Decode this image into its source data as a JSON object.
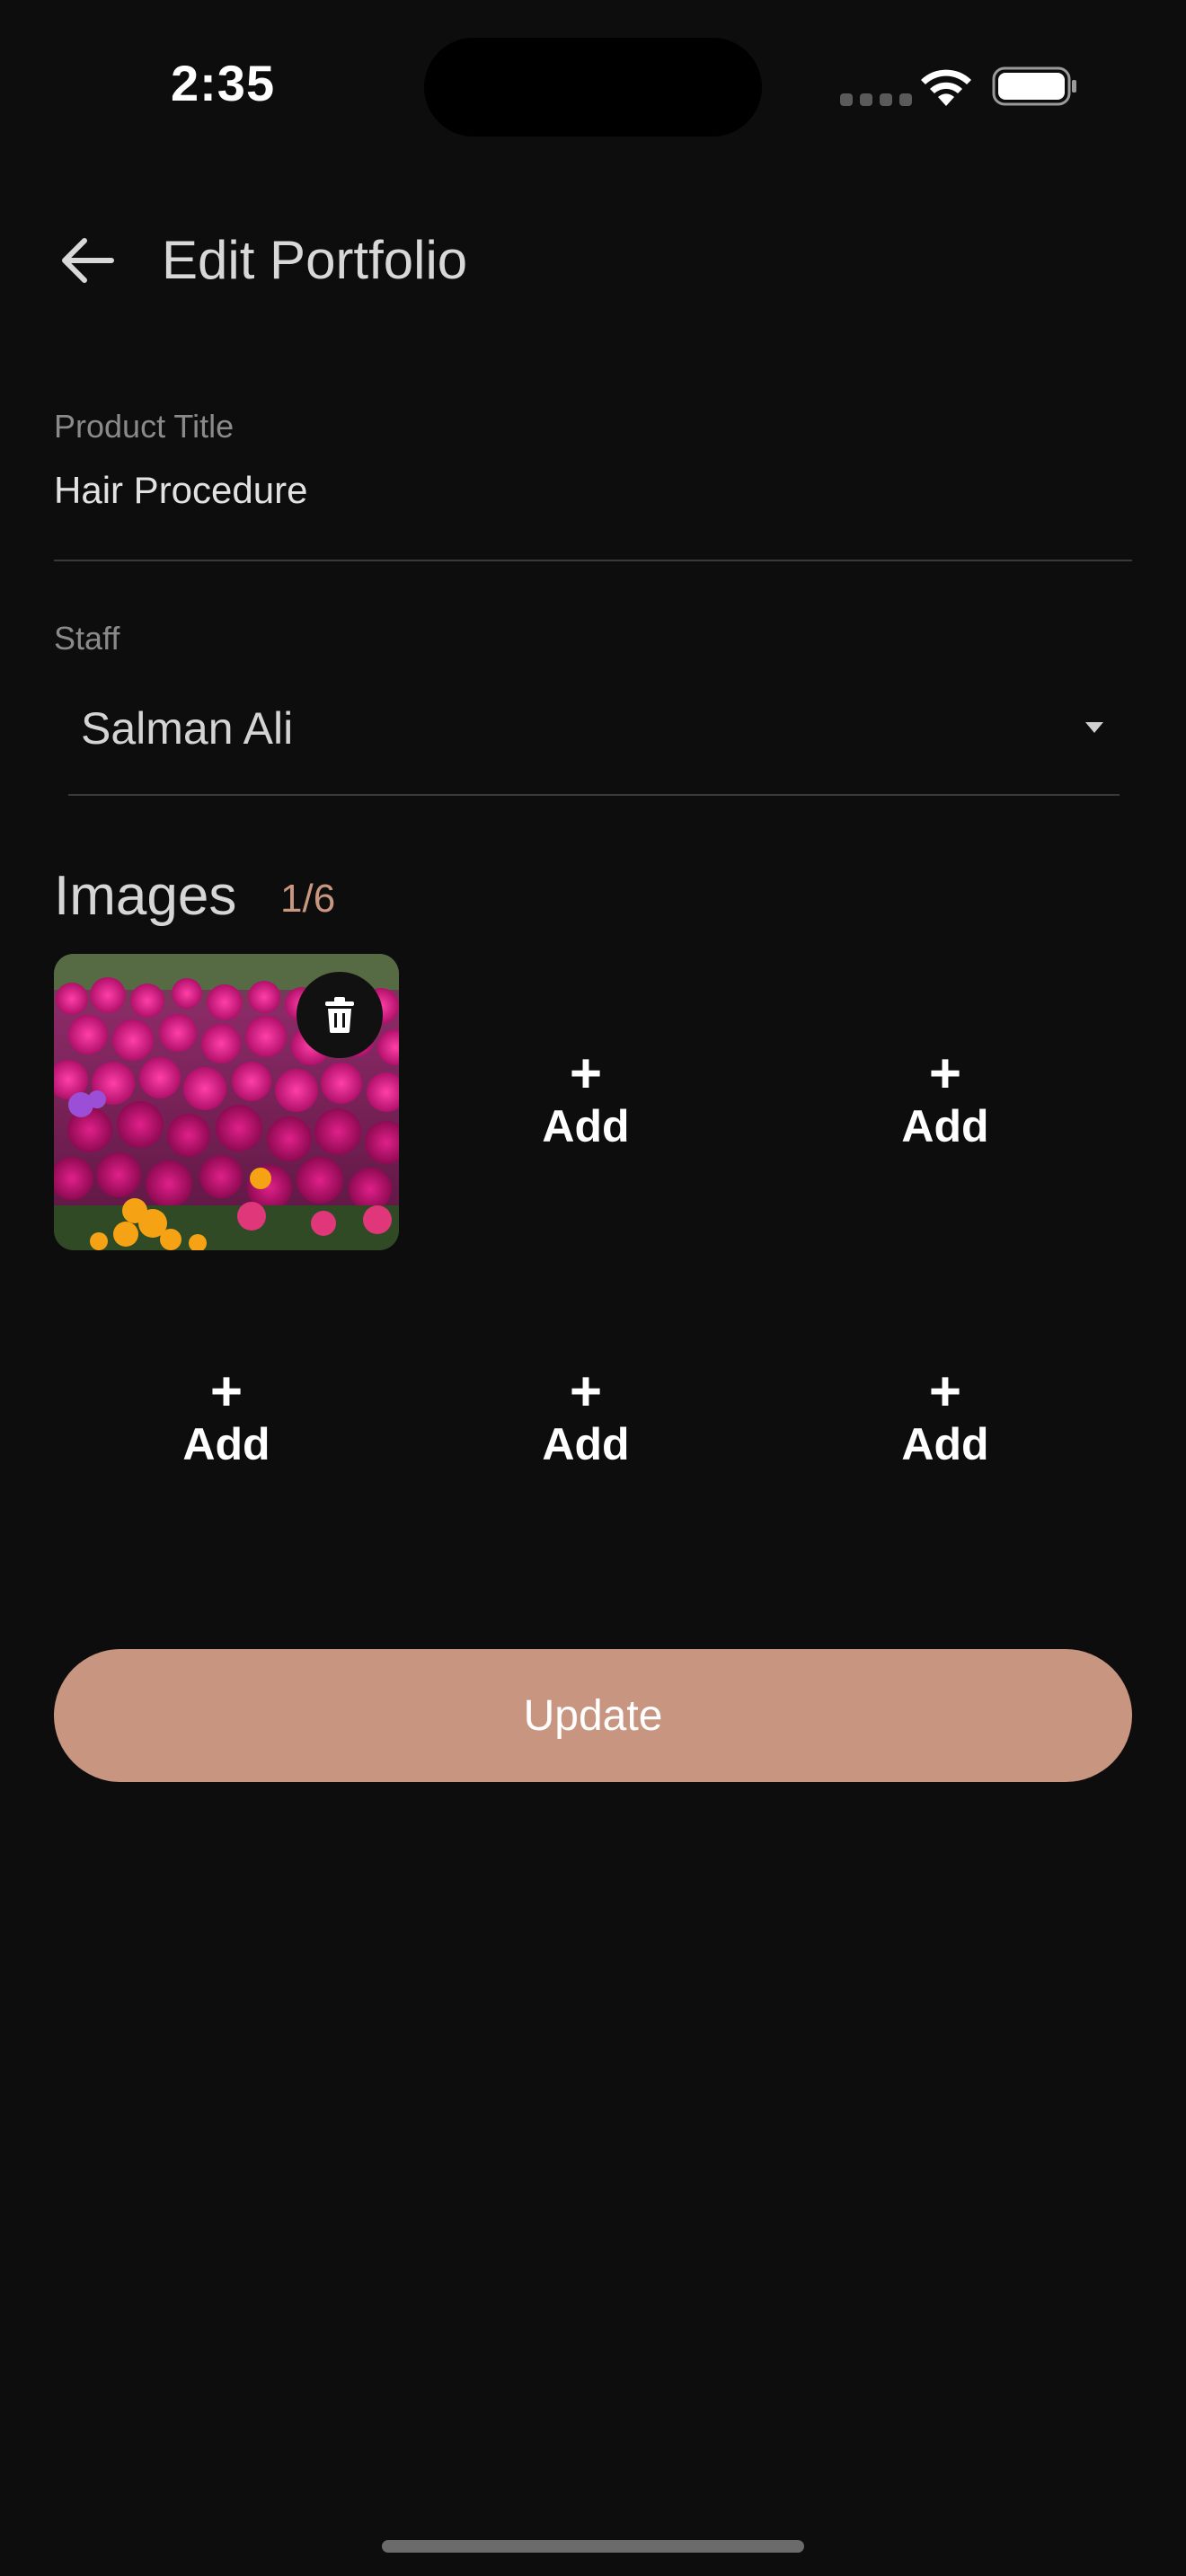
{
  "status_bar": {
    "time": "2:35"
  },
  "header": {
    "title": "Edit Portfolio",
    "back_icon": "arrow-left-icon"
  },
  "form": {
    "product_title": {
      "label": "Product Title",
      "value": "Hair Procedure"
    },
    "staff": {
      "label": "Staff",
      "selected": "Salman Ali"
    }
  },
  "images": {
    "heading": "Images",
    "count": "1/6",
    "add_label": "Add",
    "add_symbol": "+",
    "delete_icon": "trash-icon"
  },
  "actions": {
    "update_label": "Update"
  },
  "colors": {
    "background": "#0d0d0d",
    "accent": "#c89680",
    "text_primary": "#e6e6e6",
    "text_muted": "#8a8a8a"
  }
}
